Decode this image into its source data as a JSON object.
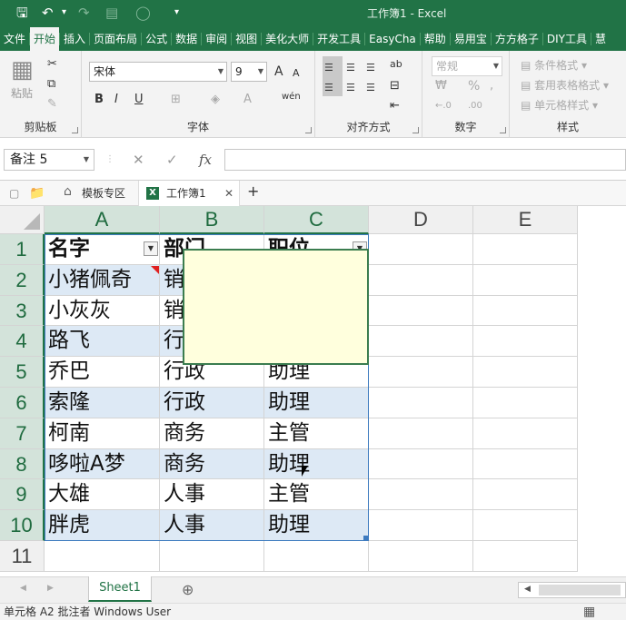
{
  "window": {
    "title": "工作簿1  -  Excel"
  },
  "quick_access": {
    "save": "🖫",
    "undo": "↶",
    "undo_menu": "▾",
    "redo": "↷",
    "form": "▤",
    "circle": "◯",
    "customize": "▾"
  },
  "ribbon_tabs": [
    "文件",
    "开始",
    "插入",
    "页面布局",
    "公式",
    "数据",
    "审阅",
    "视图",
    "美化大师",
    "开发工具",
    "EasyCha",
    "帮助",
    "易用宝",
    "方方格子",
    "DIY工具",
    "慧"
  ],
  "active_tab": "开始",
  "clipboard": {
    "paste_label": "粘贴",
    "group_label": "剪贴板",
    "paste_icon": "▦",
    "cut_icon": "✂",
    "copy_icon": "⧉",
    "brush_icon": "✎"
  },
  "font": {
    "name": "宋体",
    "size": "9",
    "grow": "A",
    "shrink": "A",
    "bold": "B",
    "italic": "I",
    "underline": "U",
    "border": "⊞",
    "fill": "◈",
    "color": "A",
    "wen": "wén",
    "group_label": "字体"
  },
  "alignment": {
    "group_label": "对齐方式",
    "orient": "ab",
    "wrap": "⇌",
    "merge": "⊟",
    "indent": "⇤"
  },
  "number": {
    "format": "常规",
    "group_label": "数字",
    "currency": "₩",
    "percent": "%",
    "comma": ",",
    "inc": "←.0",
    "dec": ".00"
  },
  "styles": {
    "conditional": "条件格式",
    "table": "套用表格格式",
    "cell": "单元格样式",
    "group_label": "样式"
  },
  "formula_bar": {
    "name_box": "备注 5",
    "cancel": "✕",
    "enter": "✓",
    "fx": "fx",
    "value": ""
  },
  "doc_tabs": {
    "new": "▢",
    "folder": "📁",
    "template": "模板专区",
    "workbook": "工作簿1",
    "close": "✕",
    "add": "+",
    "home": "⌂",
    "xls": "X"
  },
  "grid": {
    "columns": [
      "A",
      "B",
      "C",
      "D",
      "E"
    ],
    "rows": [
      "1",
      "2",
      "3",
      "4",
      "5",
      "6",
      "7",
      "8",
      "9",
      "10",
      "11"
    ],
    "headers": [
      "名字",
      "部门",
      "职位"
    ],
    "data": [
      [
        "小猪佩奇",
        "销售",
        ""
      ],
      [
        "小灰灰",
        "销售",
        ""
      ],
      [
        "路飞",
        "行政",
        ""
      ],
      [
        "乔巴",
        "行政",
        "助理"
      ],
      [
        "索隆",
        "行政",
        "助理"
      ],
      [
        "柯南",
        "商务",
        "主管"
      ],
      [
        "哆啦A梦",
        "商务",
        "助理"
      ],
      [
        "大雄",
        "人事",
        "主管"
      ],
      [
        "胖虎",
        "人事",
        "助理"
      ]
    ]
  },
  "sheets": {
    "active": "Sheet1",
    "add": "⊕"
  },
  "status": {
    "text": "单元格 A2 批注者 Windows User",
    "view": "▦"
  },
  "colors": {
    "brand": "#217346",
    "band": "#dde9f5",
    "comment_bg": "#ffffdd",
    "table_border": "#3e7bbf"
  }
}
